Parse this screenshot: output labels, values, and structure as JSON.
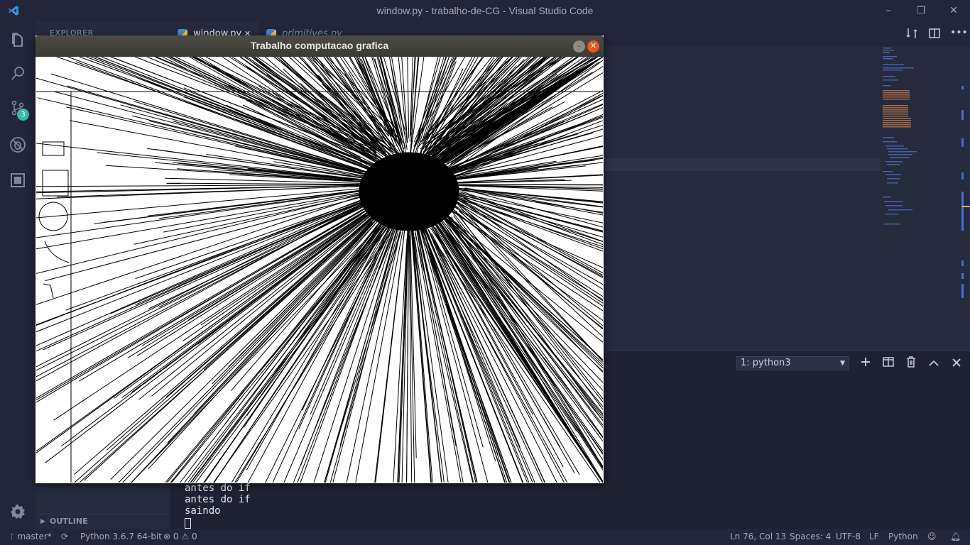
{
  "window": {
    "title": "window.py - trabalho-de-CG - Visual Studio Code",
    "controls": {
      "minimize": "–",
      "maximize": "❐",
      "close": "✕"
    }
  },
  "activity_bar": {
    "icons": [
      "files-icon",
      "search-icon",
      "source-control-icon",
      "debug-icon",
      "extensions-icon",
      "settings-gear-icon"
    ],
    "scm_badge": "3"
  },
  "sidebar": {
    "explorer_label": "EXPLORER",
    "outline_label": "OUTLINE"
  },
  "tabs": [
    {
      "label": "window.py",
      "active": true,
      "close": "✕"
    },
    {
      "label": "primitives.py",
      "active": false
    }
  ],
  "terminal": {
    "selected": "1: python3",
    "output": [
      "antes do if",
      "antes do if",
      "saindo"
    ],
    "actions": [
      "add-terminal-icon",
      "split-terminal-icon",
      "trash-icon",
      "chevron-up-icon",
      "close-icon"
    ]
  },
  "status_bar": {
    "branch": "master*",
    "python": "Python 3.6.7 64-bit",
    "errors": "0",
    "warnings": "0",
    "position": "Ln 76, Col 13",
    "spaces": "Spaces: 4",
    "encoding": "UTF-8",
    "eol": "LF",
    "language": "Python"
  },
  "app_window": {
    "title": "Trabalho computacao grafica",
    "minimize": "–",
    "close": "✕"
  },
  "colors": {
    "editor_bg": "#262a3d",
    "status_bg": "#23263a",
    "accent": "#3bb9a5",
    "close_button": "#e25a1c"
  }
}
